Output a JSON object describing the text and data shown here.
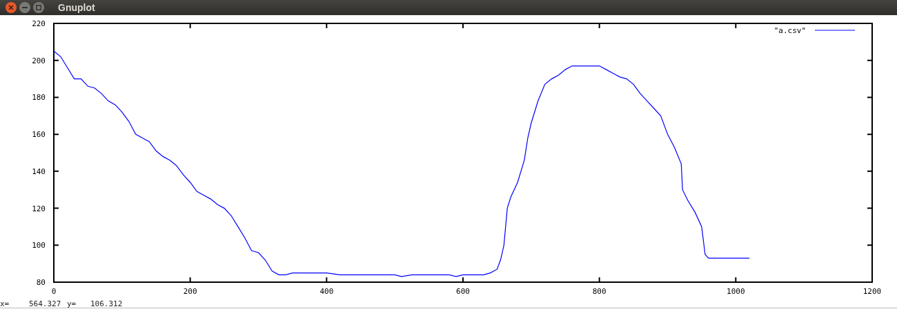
{
  "window": {
    "title": "Gnuplot"
  },
  "plot": {
    "chart_data": {
      "type": "line",
      "xlim": [
        0,
        1200
      ],
      "ylim": [
        80,
        220
      ],
      "xticks": [
        0,
        200,
        400,
        600,
        800,
        1000,
        1200
      ],
      "yticks": [
        80,
        100,
        120,
        140,
        160,
        180,
        200,
        220
      ],
      "x": [
        0,
        10,
        20,
        30,
        40,
        50,
        60,
        70,
        80,
        90,
        100,
        110,
        120,
        130,
        140,
        150,
        160,
        170,
        180,
        190,
        200,
        210,
        220,
        230,
        240,
        250,
        260,
        270,
        280,
        290,
        300,
        310,
        320,
        330,
        340,
        350,
        400,
        420,
        500,
        510,
        525,
        580,
        590,
        600,
        630,
        640,
        650,
        655,
        660,
        665,
        670,
        680,
        690,
        695,
        700,
        710,
        720,
        730,
        740,
        750,
        760,
        800,
        810,
        820,
        830,
        840,
        850,
        860,
        870,
        880,
        890,
        900,
        910,
        920,
        922,
        930,
        940,
        950,
        955,
        960,
        1020
      ],
      "series": [
        {
          "name": "\"a.csv\"",
          "color": "#0000ff",
          "values": [
            205,
            202,
            196,
            190,
            190,
            186,
            185,
            182,
            178,
            176,
            172,
            167,
            160,
            158,
            156,
            151,
            148,
            146,
            143,
            138,
            134,
            129,
            127,
            125,
            122,
            120,
            116,
            110,
            104,
            97,
            96,
            92,
            86,
            84,
            84,
            85,
            85,
            84,
            84,
            83,
            84,
            84,
            83,
            84,
            84,
            85,
            87,
            92,
            100,
            120,
            126,
            134,
            146,
            158,
            166,
            178,
            187,
            190,
            192,
            195,
            197,
            197,
            195,
            193,
            191,
            190,
            187,
            182,
            178,
            174,
            170,
            160,
            153,
            144,
            130,
            124,
            118,
            110,
            95,
            93,
            93
          ]
        }
      ]
    }
  },
  "status_bar": {
    "x_label": "x=",
    "x_value": "564.327",
    "y_label": "y=",
    "y_value": "106.312"
  }
}
